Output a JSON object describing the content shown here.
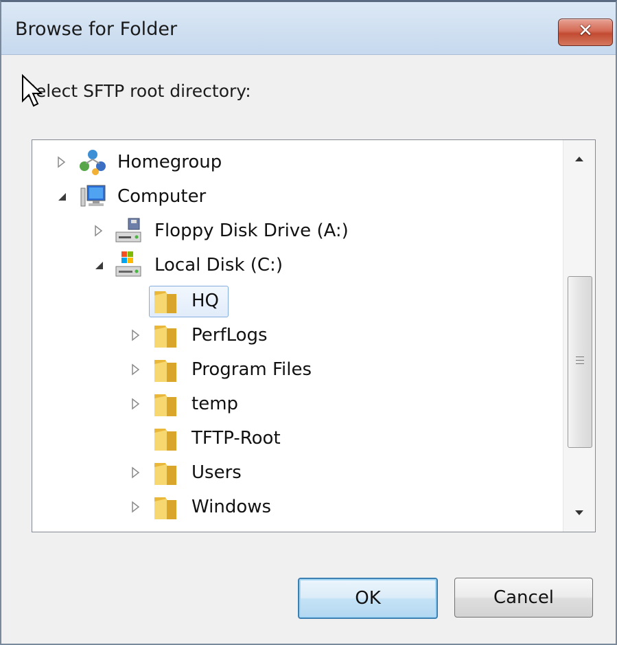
{
  "window": {
    "title": "Browse for Folder",
    "close_label": "✕"
  },
  "prompt": "Select SFTP root directory:",
  "tree": {
    "items": [
      {
        "label": "Homegroup",
        "icon": "homegroup-icon",
        "expander": "collapsed"
      },
      {
        "label": "Computer",
        "icon": "computer-icon",
        "expander": "expanded"
      },
      {
        "label": "Floppy Disk Drive (A:)",
        "icon": "floppy-drive-icon",
        "expander": "collapsed"
      },
      {
        "label": "Local Disk (C:)",
        "icon": "local-disk-icon",
        "expander": "expanded"
      },
      {
        "label": "HQ",
        "icon": "folder-icon",
        "expander": "none",
        "selected": true
      },
      {
        "label": "PerfLogs",
        "icon": "folder-icon",
        "expander": "collapsed"
      },
      {
        "label": "Program Files",
        "icon": "folder-icon",
        "expander": "collapsed"
      },
      {
        "label": "temp",
        "icon": "folder-icon",
        "expander": "collapsed"
      },
      {
        "label": "TFTP-Root",
        "icon": "folder-icon",
        "expander": "none"
      },
      {
        "label": "Users",
        "icon": "folder-icon",
        "expander": "collapsed"
      },
      {
        "label": "Windows",
        "icon": "folder-icon",
        "expander": "collapsed"
      }
    ]
  },
  "buttons": {
    "ok_label": "OK",
    "cancel_label": "Cancel"
  },
  "colors": {
    "selection_border": "#84acdd",
    "close_button": "#c24b32",
    "folder_yellow": "#f0c94a"
  }
}
